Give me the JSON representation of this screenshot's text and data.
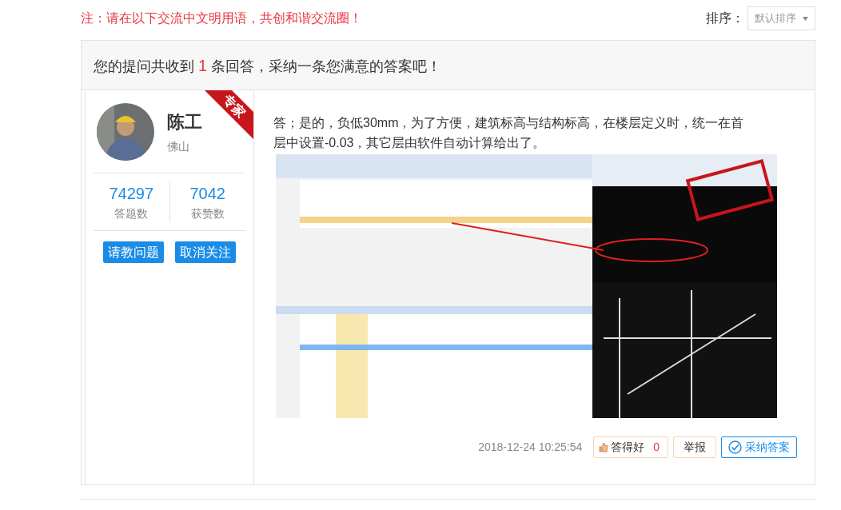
{
  "notice": "注：请在以下交流中文明用语，共创和谐交流圈！",
  "sort": {
    "label": "排序：",
    "value": "默认排序"
  },
  "summary": {
    "before": "您的提问共收到",
    "count": "1",
    "after": "条回答，采纳一条您满意的答案吧！"
  },
  "answer": {
    "user": {
      "name": "陈工",
      "location": "佛山",
      "badge": "专家",
      "stats": [
        {
          "value": "74297",
          "label": "答题数"
        },
        {
          "value": "7042",
          "label": "获赞数"
        }
      ],
      "buttons": [
        "请教问题",
        "取消关注"
      ]
    },
    "text": "答；是的，负低30mm，为了方便，建筑标高与结构标高，在楼层定义时，统一在首层中设置-0.03，其它层由软件自动计算给出了。",
    "time": "2018-12-24 10:25:54",
    "actions": [
      {
        "kind": "like",
        "label": "答得好",
        "count": "0"
      },
      {
        "kind": "report",
        "label": "举报"
      },
      {
        "kind": "accept",
        "label": "采纳答案"
      }
    ]
  }
}
